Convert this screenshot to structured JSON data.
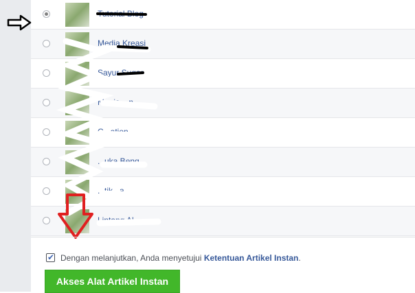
{
  "page_list": {
    "items": [
      {
        "name": "Tutorial Blog",
        "selected": true
      },
      {
        "name": "Media Kreasi",
        "selected": false
      },
      {
        "name": "Sayur Sugar",
        "selected": false
      },
      {
        "name": "Manis....n",
        "selected": false
      },
      {
        "name": "C...ation",
        "selected": false
      },
      {
        "name": "...uka Benq",
        "selected": false
      },
      {
        "name": "...tik...a",
        "selected": false
      },
      {
        "name": "Lintang Al...",
        "selected": false
      }
    ]
  },
  "footer": {
    "agree_prefix": "Dengan melanjutkan, Anda menyetujui ",
    "agree_link": "Ketentuan Artikel Instan",
    "agree_suffix": ".",
    "agreed": true,
    "button_label": "Akses Alat Artikel Instan"
  },
  "colors": {
    "button": "#42b72a",
    "link": "#365899",
    "annotation_arrow": "#e02020",
    "pointer_arrow": "#000000"
  },
  "icons": [
    "radio-icon",
    "checkbox-icon",
    "pointer-arrow-icon",
    "down-arrow-icon"
  ]
}
